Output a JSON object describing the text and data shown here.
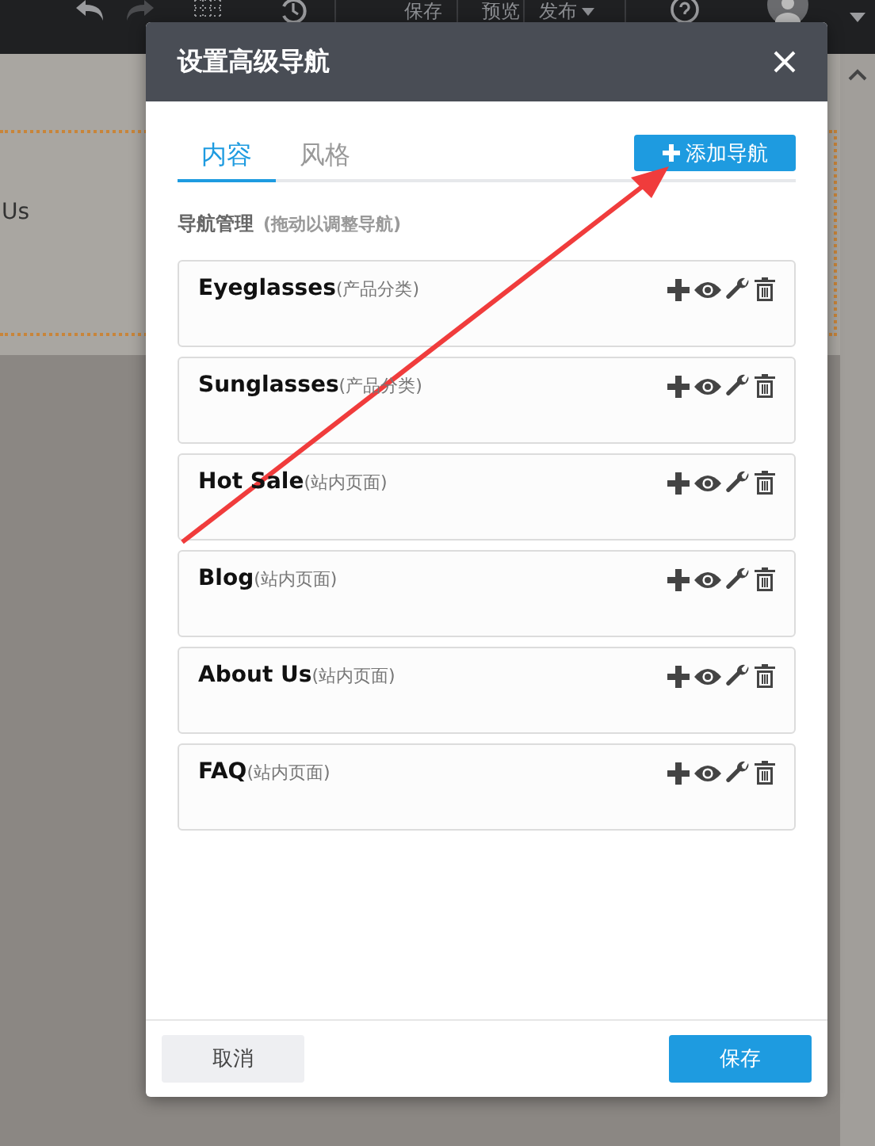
{
  "toolbar": {
    "buttons": [
      "保存",
      "预览",
      "发布"
    ]
  },
  "page": {
    "text": "Us"
  },
  "dialog": {
    "title": "设置高级导航",
    "tabs": [
      {
        "label": "内容",
        "selected": true
      },
      {
        "label": "风格",
        "selected": false
      }
    ],
    "add_button": "添加导航",
    "section_title": "导航管理",
    "section_hint": "(拖动以调整导航)",
    "items": [
      {
        "name": "Eyeglasses",
        "type": "(产品分类)"
      },
      {
        "name": "Sunglasses",
        "type": "(产品分类)"
      },
      {
        "name": "Hot Sale",
        "type": "(站内页面)"
      },
      {
        "name": "Blog",
        "type": "(站内页面)"
      },
      {
        "name": "About Us",
        "type": "(站内页面)"
      },
      {
        "name": "FAQ",
        "type": "(站内页面)"
      }
    ],
    "cancel_button": "取消",
    "save_button": "保存"
  }
}
